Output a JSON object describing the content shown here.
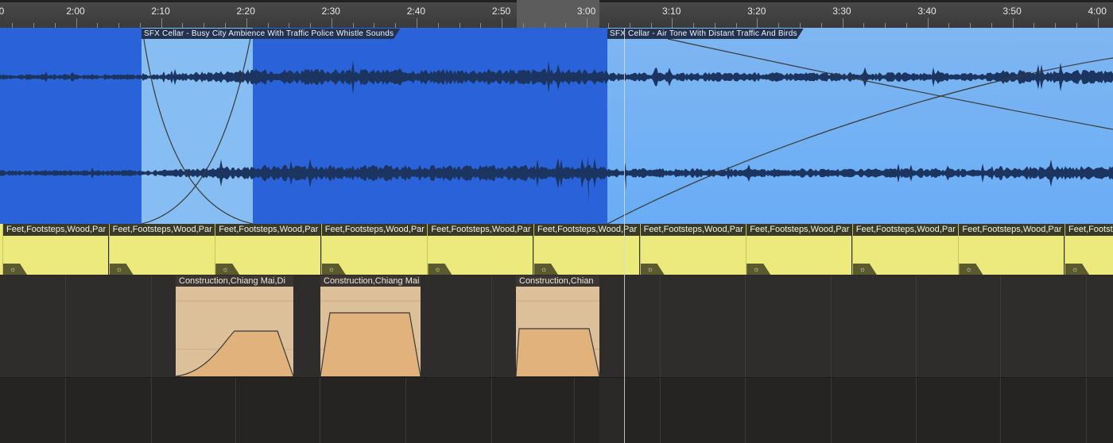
{
  "ruler": {
    "labels": [
      "2:00",
      "2:10",
      "2:20",
      "2:30",
      "2:40",
      "2:50",
      "3:00",
      "3:10",
      "3:20",
      "3:30",
      "3:40",
      "3:50",
      "4:00"
    ],
    "partial_label": "0"
  },
  "audio_track": {
    "clips": [
      {
        "label": "SFX Cellar - Busy City Ambience With Traffic Police Whistle Sounds"
      },
      {
        "label": "SFX Cellar - Air Tone With Distant Traffic And Birds"
      }
    ],
    "colors": {
      "selected": "#2a63d9",
      "unselected": "#6aaef5",
      "crossfade": "#86bdf2",
      "waveform": "#1b3560"
    }
  },
  "footsteps_track": {
    "clip_label": "Feet,Footsteps,Wood,Par",
    "clip_count": 11,
    "gear_glyph": "☼",
    "color": "#ecea7c"
  },
  "construction_track": {
    "clips": [
      {
        "label": "Construction,Chiang Mai,Di"
      },
      {
        "label": "Construction,Chiang Mai"
      },
      {
        "label": "Construction,Chian"
      }
    ],
    "color": "#dcc09a"
  }
}
